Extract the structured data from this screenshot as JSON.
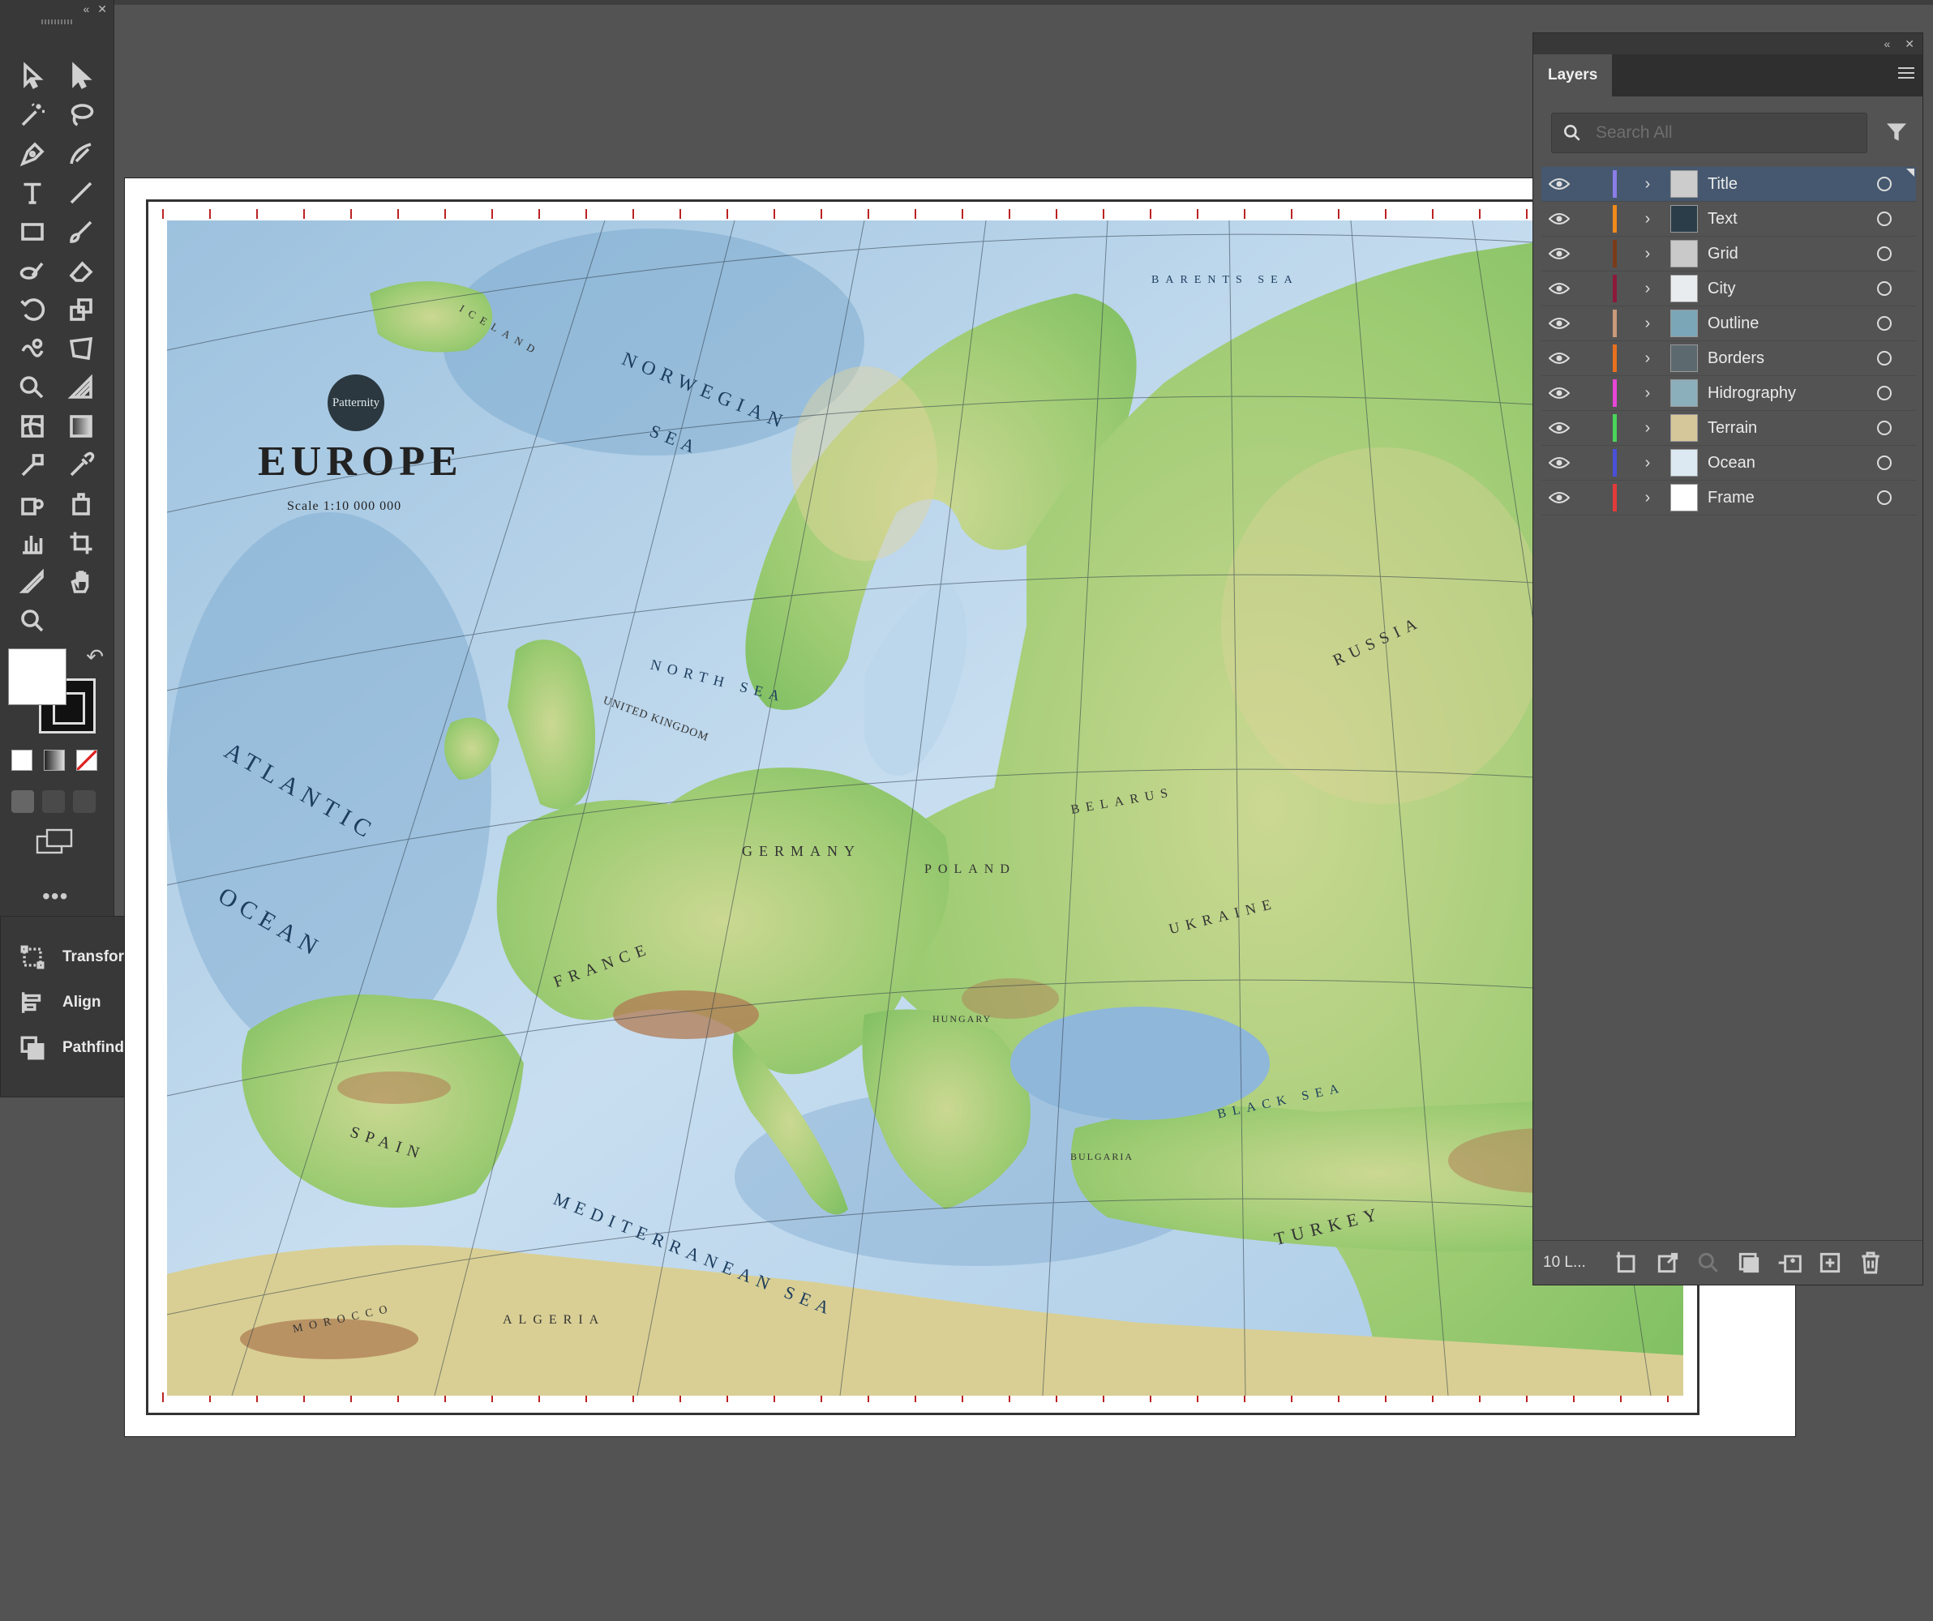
{
  "layers_panel": {
    "tab_label": "Layers",
    "search_placeholder": "Search All",
    "layer_count_label": "10 L...",
    "layers": [
      {
        "name": "Title",
        "color": "#8a7de6",
        "selected": true
      },
      {
        "name": "Text",
        "color": "#f08a1c",
        "selected": false
      },
      {
        "name": "Grid",
        "color": "#7a3b1a",
        "selected": false
      },
      {
        "name": "City",
        "color": "#8b1a3a",
        "selected": false
      },
      {
        "name": "Outline",
        "color": "#c99a7a",
        "selected": false
      },
      {
        "name": "Borders",
        "color": "#e8701e",
        "selected": false
      },
      {
        "name": "Hidrography",
        "color": "#e646d6",
        "selected": false
      },
      {
        "name": "Terrain",
        "color": "#4ad45a",
        "selected": false
      },
      {
        "name": "Ocean",
        "color": "#4a50d8",
        "selected": false
      },
      {
        "name": "Frame",
        "color": "#e23b3b",
        "selected": false
      }
    ]
  },
  "small_panel": {
    "items": [
      {
        "label": "Transform",
        "icon": "transform-icon"
      },
      {
        "label": "Align",
        "icon": "align-icon"
      },
      {
        "label": "Pathfinder",
        "icon": "pathfinder-icon"
      }
    ]
  },
  "map": {
    "logo": "Patternity",
    "title": "EUROPE",
    "scale": "Scale 1:10 000 000",
    "labels": {
      "atlantic": "ATLANTIC",
      "ocean": "OCEAN",
      "norwegian": "NORWEGIAN",
      "sea": "SEA",
      "north_sea": "NORTH SEA",
      "mediterranean": "MEDITERRANEAN SEA",
      "black_sea": "BLACK SEA",
      "barents": "BARENTS SEA",
      "germany": "GERMANY",
      "poland": "POLAND",
      "belarus": "BELARUS",
      "ukraine": "UKRAINE",
      "russia": "RUSSIA",
      "turkey": "TURKEY",
      "spain": "SPAIN",
      "france": "FRANCE",
      "algeria": "ALGERIA",
      "morocco": "MOROCCO",
      "united_kingdom": "UNITED KINGDOM",
      "iceland": "ICELAND",
      "hungary": "HUNGARY",
      "bulgaria": "BULGARIA"
    }
  },
  "colors": {
    "background": "#535353",
    "panel": "#383838",
    "selection": "#45586f",
    "sea_light": "#cfe3f2",
    "sea_deep": "#7ba9cf",
    "land_low": "#8fc46a",
    "land_high": "#e9d9a0",
    "mountains": "#b07a52"
  }
}
